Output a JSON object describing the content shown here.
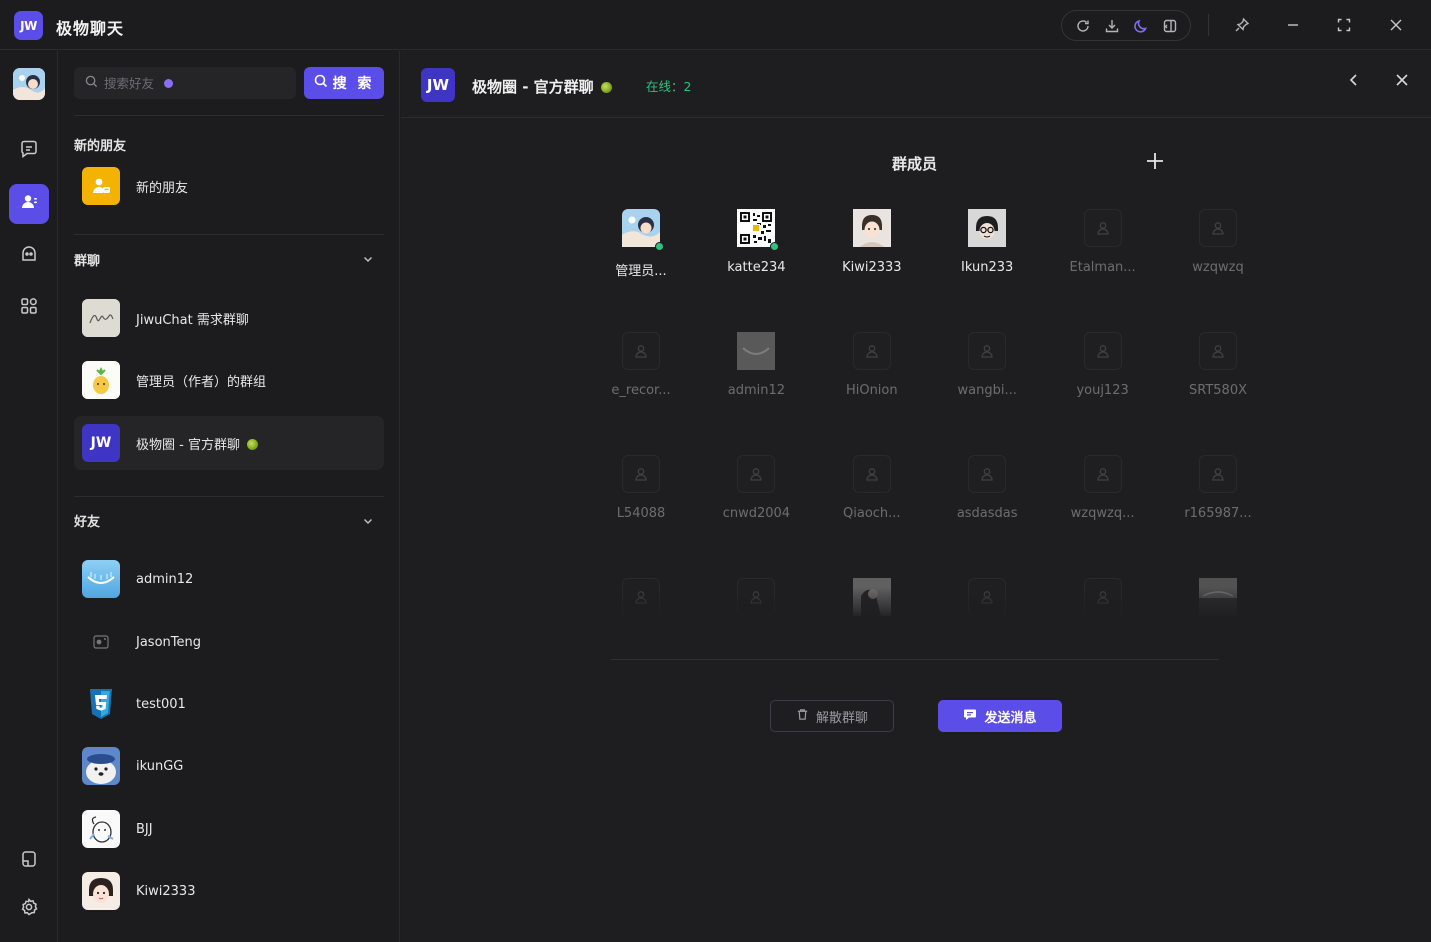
{
  "app": {
    "logo_text": "JW",
    "title": "极物聊天"
  },
  "colors": {
    "accent": "#5b4ee8",
    "online": "#2ec27e",
    "background": "#1c1c1e"
  },
  "titlebar_tools": [
    "refresh-icon",
    "download-icon",
    "moon-icon",
    "layout-icon"
  ],
  "window_controls": [
    "pin-icon",
    "minimize-icon",
    "maximize-icon",
    "close-icon"
  ],
  "rail": {
    "items": [
      "chat-icon",
      "contacts-icon",
      "robot-icon",
      "apps-icon"
    ],
    "bottom": [
      "file-icon",
      "settings-icon"
    ]
  },
  "search": {
    "placeholder": "搜索好友",
    "button_label": "搜 索"
  },
  "new_friends": {
    "section_title": "新的朋友",
    "item_label": "新的朋友"
  },
  "groups": {
    "section_title": "群聊",
    "items": [
      {
        "name": "JiwuChat 需求群聊"
      },
      {
        "name": "管理员（作者）的群组"
      },
      {
        "name": "极物圈 - 官方群聊"
      }
    ]
  },
  "friends": {
    "section_title": "好友",
    "items": [
      {
        "name": "admin12"
      },
      {
        "name": "JasonTeng"
      },
      {
        "name": "test001"
      },
      {
        "name": "ikunGG"
      },
      {
        "name": "BJJ"
      },
      {
        "name": "Kiwi2333"
      }
    ]
  },
  "chat_header": {
    "logo_text": "JW",
    "title": "极物圈 - 官方群聊",
    "online_text": "在线：2"
  },
  "members_panel": {
    "title": "群成员",
    "members": [
      {
        "name": "管理员...",
        "online": true
      },
      {
        "name": "katte234",
        "online": true
      },
      {
        "name": "Kiwi2333",
        "online": false
      },
      {
        "name": "Ikun233",
        "online": false
      },
      {
        "name": "Etalman...",
        "online": false
      },
      {
        "name": "wzqwzq",
        "online": false
      },
      {
        "name": "e_recor...",
        "online": false
      },
      {
        "name": "admin12",
        "online": false
      },
      {
        "name": "HiOnion",
        "online": false
      },
      {
        "name": "wangbi...",
        "online": false
      },
      {
        "name": "youj123",
        "online": false
      },
      {
        "name": "SRT580X",
        "online": false
      },
      {
        "name": "L54088",
        "online": false
      },
      {
        "name": "cnwd2004",
        "online": false
      },
      {
        "name": "Qiaoch...",
        "online": false
      },
      {
        "name": "asdasdas",
        "online": false
      },
      {
        "name": "wzqwzq...",
        "online": false
      },
      {
        "name": "r165987...",
        "online": false
      },
      {
        "name": "",
        "online": false
      },
      {
        "name": "",
        "online": false
      },
      {
        "name": "",
        "online": false
      },
      {
        "name": "",
        "online": false
      },
      {
        "name": "",
        "online": false
      },
      {
        "name": "",
        "online": false
      }
    ],
    "dismiss_label": "解散群聊",
    "send_label": "发送消息"
  }
}
